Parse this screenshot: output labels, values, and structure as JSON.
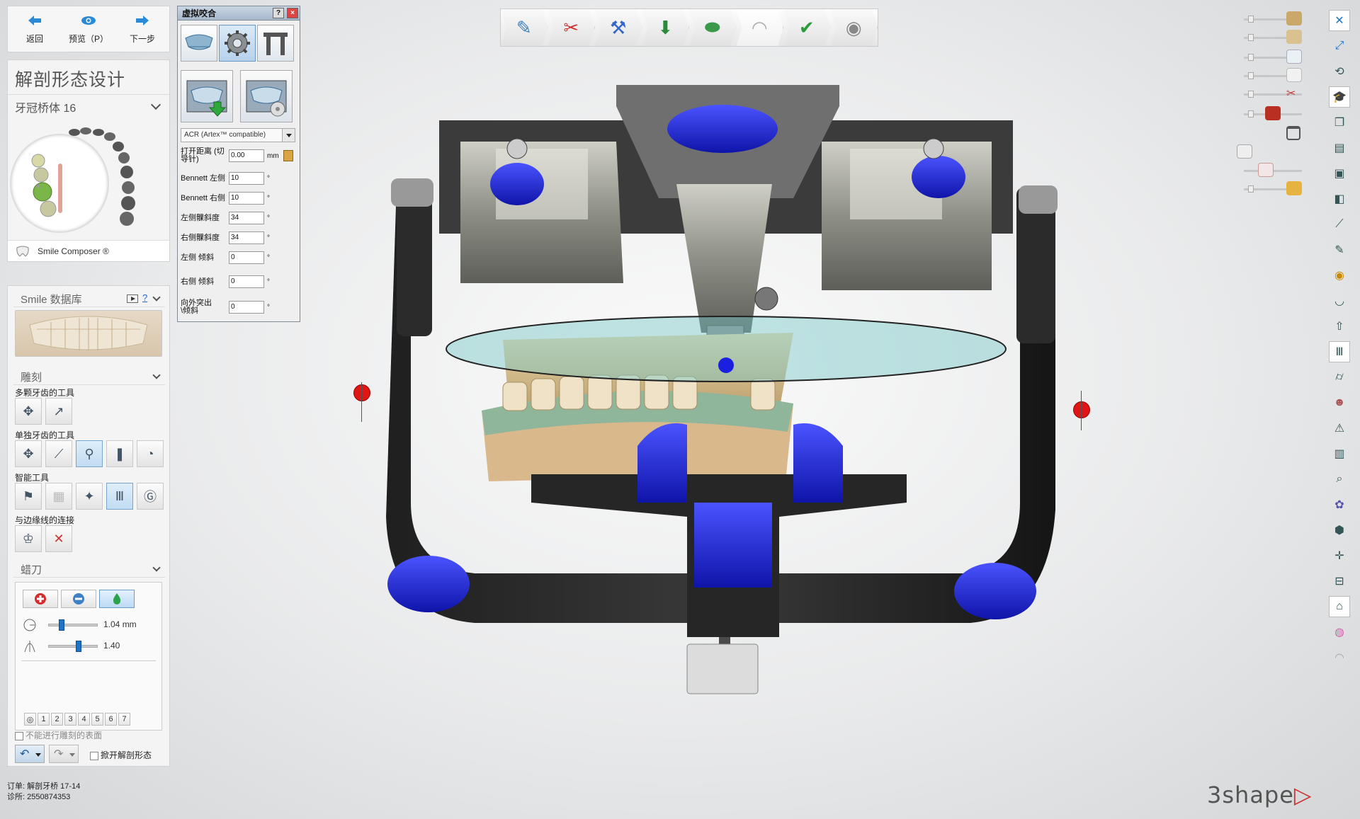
{
  "nav": {
    "back_label": "返回",
    "preview_label": "预览（P）",
    "next_label": "下一步"
  },
  "design": {
    "title": "解剖形态设计",
    "tooth_selector": "牙冠桥体 16",
    "smile_composer": "Smile Composer ®"
  },
  "library": {
    "title": "Smile 数据库",
    "help": "?"
  },
  "sculpt": {
    "title": "雕刻",
    "multi_label": "多颗牙齿的工具",
    "single_label": "单独牙齿的工具",
    "smart_label": "智能工具",
    "margin_label": "与边缘线的连接"
  },
  "wax": {
    "title": "蜡刀",
    "radius_value": "1.04 mm",
    "strength_value": "1.40",
    "presets": [
      "1",
      "2",
      "3",
      "4",
      "5",
      "6",
      "7"
    ],
    "no_sculpt_label": "不能进行雕刻的表面",
    "keep_shape_label": "掀开解剖形态"
  },
  "order": {
    "order_label": "订单:",
    "order_value": "解剖牙桥 17-14",
    "case_label": "诊所:",
    "case_value": "2550874353"
  },
  "articulator": {
    "title": "虚拟咬合",
    "help": "?",
    "close": "×",
    "model": "ACR (Artex™ compatible)",
    "rows": [
      {
        "label": "打开距离 (切导针)",
        "value": "0.00",
        "unit": "mm"
      },
      {
        "label": "Bennett 左侧",
        "value": "10",
        "unit": "°"
      },
      {
        "label": "Bennett 右侧",
        "value": "10",
        "unit": "°"
      },
      {
        "label": "左侧髁斜度",
        "value": "34",
        "unit": "°"
      },
      {
        "label": "右侧髁斜度",
        "value": "34",
        "unit": "°"
      },
      {
        "label": "左侧 倾斜",
        "value": "0",
        "unit": "°"
      },
      {
        "label": "右侧 倾斜",
        "value": "0",
        "unit": "°"
      },
      {
        "label": "向外突出 \\倾斜",
        "value": "0",
        "unit": "°"
      }
    ]
  },
  "topbar": {
    "items": [
      "margin-icon",
      "cut-icon",
      "wand-icon",
      "place-icon",
      "gingiva-icon",
      "tooth-icon",
      "check-tooth-icon",
      "disc-icon"
    ]
  },
  "brand": {
    "name": "3shape",
    "mark": "▷"
  },
  "colors": {
    "accent": "#1c74c9",
    "articulator_blue": "#1a1fe0",
    "marker_red": "#e01515",
    "plane_teal": "#78c7c7"
  }
}
